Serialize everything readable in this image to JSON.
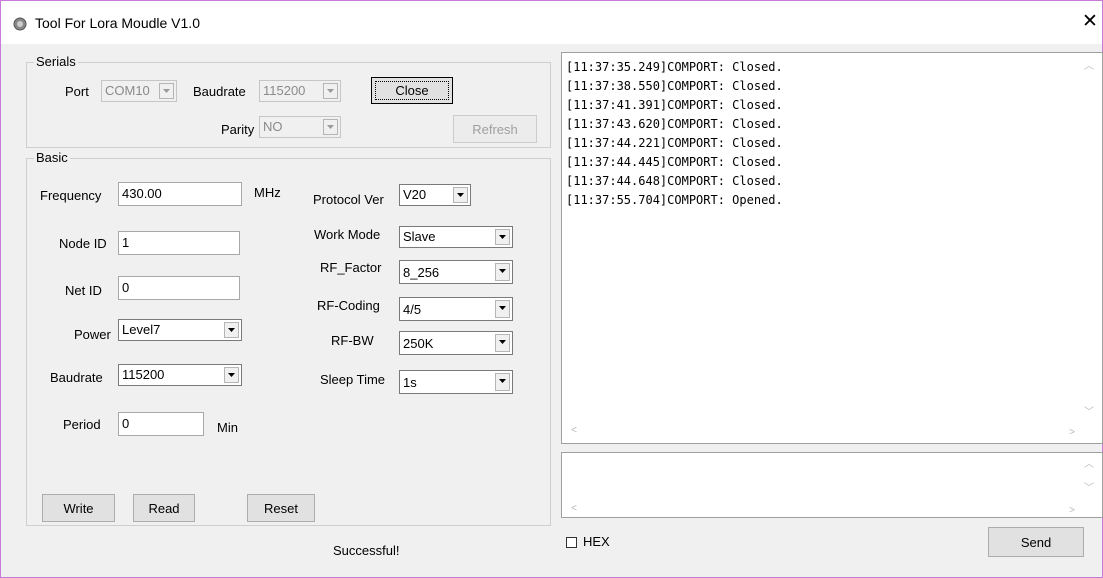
{
  "window": {
    "title": "Tool For Lora Moudle V1.0",
    "close_glyph": "✕"
  },
  "serials": {
    "legend": "Serials",
    "port_label": "Port",
    "port_value": "COM10",
    "baudrate_label": "Baudrate",
    "baudrate_value": "115200",
    "parity_label": "Parity",
    "parity_value": "NO",
    "close_button": "Close",
    "refresh_button": "Refresh"
  },
  "basic": {
    "legend": "Basic",
    "frequency_label": "Frequency",
    "frequency_value": "430.00",
    "frequency_unit": "MHz",
    "node_id_label": "Node ID",
    "node_id_value": "1",
    "net_id_label": "Net ID",
    "net_id_value": "0",
    "power_label": "Power",
    "power_value": "Level7",
    "baudrate_label": "Baudrate",
    "baudrate_value": "115200",
    "period_label": "Period",
    "period_value": "0",
    "period_unit": "Min",
    "protocol_label": "Protocol Ver",
    "protocol_value": "V20",
    "work_mode_label": "Work Mode",
    "work_mode_value": "Slave",
    "rf_factor_label": "RF_Factor",
    "rf_factor_value": "8_256",
    "rf_coding_label": "RF-Coding",
    "rf_coding_value": "4/5",
    "rf_bw_label": "RF-BW",
    "rf_bw_value": "250K",
    "sleep_time_label": "Sleep Time",
    "sleep_time_value": "1s",
    "write_button": "Write",
    "read_button": "Read",
    "reset_button": "Reset"
  },
  "status": {
    "message": "Successful!"
  },
  "log": {
    "lines": [
      "[11:37:35.249]COMPORT: Closed.",
      "[11:37:38.550]COMPORT: Closed.",
      "[11:37:41.391]COMPORT: Closed.",
      "[11:37:43.620]COMPORT: Closed.",
      "[11:37:44.221]COMPORT: Closed.",
      "[11:37:44.445]COMPORT: Closed.",
      "[11:37:44.648]COMPORT: Closed.",
      "[11:37:55.704]COMPORT: Opened."
    ]
  },
  "send": {
    "input_value": "",
    "hex_label": "HEX",
    "hex_checked": false,
    "send_button": "Send"
  },
  "icons": {
    "app": "app-gear-icon",
    "dropdown": "chevron-down-icon",
    "scroll_up": "scroll-up-icon",
    "scroll_down": "scroll-down-icon",
    "scroll_left": "scroll-left-icon",
    "scroll_right": "scroll-right-icon"
  }
}
